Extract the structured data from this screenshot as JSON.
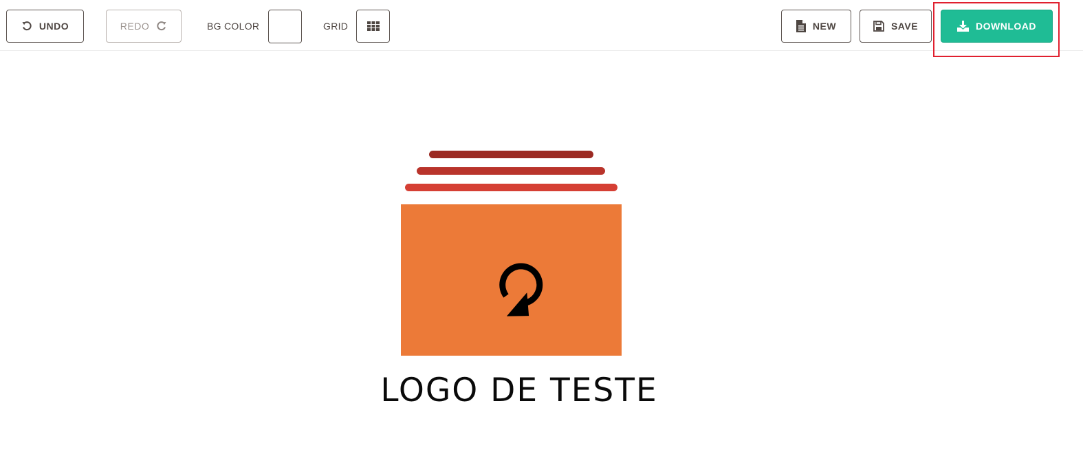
{
  "toolbar": {
    "undo_label": "UNDO",
    "redo_label": "REDO",
    "bg_color_label": "BG COLOR",
    "bg_color_value": "#ffffff",
    "grid_label": "GRID",
    "new_label": "NEW",
    "save_label": "SAVE",
    "download_label": "DOWNLOAD"
  },
  "icons": {
    "undo": "undo-icon",
    "redo": "redo-icon",
    "grid": "grid-icon",
    "new": "document-icon",
    "save": "floppy-disk-icon",
    "download": "download-icon",
    "logo_symbol": "rotate-arrow-icon"
  },
  "colors": {
    "primary": "#1fbc95",
    "highlight": "#e0202f",
    "logo_box": "#ec7a38",
    "bar_top": "#9b2a22",
    "bar_middle": "#b9342b",
    "bar_bottom": "#d53f34"
  },
  "logo": {
    "text": "LOGO DE TESTE"
  }
}
